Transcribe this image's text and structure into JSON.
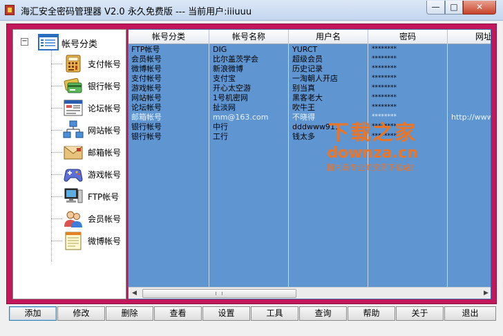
{
  "window": {
    "title": "海汇安全密码管理器 V2.0 永久免费版 --- 当前用户:iiiuuu",
    "min_label": "—",
    "max_label": "□",
    "close_label": "✕"
  },
  "tree": {
    "root_label": "帐号分类",
    "toggle": "−",
    "items": [
      {
        "label": "支付帐号",
        "icon": "payment-calculator-icon"
      },
      {
        "label": "银行帐号",
        "icon": "bank-cards-icon"
      },
      {
        "label": "论坛帐号",
        "icon": "forum-window-icon"
      },
      {
        "label": "网站帐号",
        "icon": "network-computers-icon"
      },
      {
        "label": "邮箱帐号",
        "icon": "envelope-icon"
      },
      {
        "label": "游戏帐号",
        "icon": "gamepad-icon"
      },
      {
        "label": "FTP帐号",
        "icon": "ftp-computer-icon"
      },
      {
        "label": "会员帐号",
        "icon": "members-people-icon"
      },
      {
        "label": "微博帐号",
        "icon": "notepad-icon"
      }
    ]
  },
  "grid": {
    "columns": [
      "帐号分类",
      "帐号名称",
      "用户名",
      "密码",
      "网址"
    ],
    "rows": [
      {
        "category": "FTP帐号",
        "name": "DIG",
        "user": "YURCT",
        "password": "********",
        "url": ""
      },
      {
        "category": "会员帐号",
        "name": "比尔盖茨学会",
        "user": "超级会员",
        "password": "********",
        "url": ""
      },
      {
        "category": "微博帐号",
        "name": "新浪微博",
        "user": "历史记录",
        "password": "********",
        "url": ""
      },
      {
        "category": "支付帐号",
        "name": "支付宝",
        "user": "一淘朝人开店",
        "password": "********",
        "url": ""
      },
      {
        "category": "游戏帐号",
        "name": "开心太空游",
        "user": "别当真",
        "password": "********",
        "url": ""
      },
      {
        "category": "网站帐号",
        "name": "1号机密网",
        "user": "黑客老大",
        "password": "********",
        "url": ""
      },
      {
        "category": "论坛帐号",
        "name": "扯淡网",
        "user": "吹牛王",
        "password": "********",
        "url": ""
      },
      {
        "category": "邮箱帐号",
        "name": "mm@163.com",
        "user": "不晓得",
        "password": "********",
        "url": "http://www"
      },
      {
        "category": "银行帐号",
        "name": "中行",
        "user": "dddwww911",
        "password": "********",
        "url": ""
      },
      {
        "category": "银行帐号",
        "name": "工行",
        "user": "钱太多",
        "password": "********",
        "url": ""
      }
    ],
    "selected_row": 7
  },
  "watermark": {
    "line1": "下载之家",
    "line2": "downza.cn",
    "line3": "国内最专业的资源下载站！"
  },
  "toolbar": {
    "buttons": [
      "添加",
      "修改",
      "删除",
      "查看",
      "设置",
      "工具",
      "查询",
      "帮助",
      "关于",
      "退出"
    ],
    "active": 0
  },
  "colors": {
    "frame": "#c2185b",
    "grid_bg": "#5f95d1",
    "watermark": "#e8762a"
  }
}
